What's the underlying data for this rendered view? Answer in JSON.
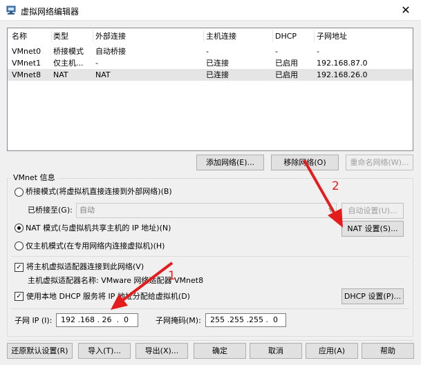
{
  "window": {
    "title": "虚拟网络编辑器",
    "close_glyph": "✕"
  },
  "network_table": {
    "columns": [
      "名称",
      "类型",
      "外部连接",
      "主机连接",
      "DHCP",
      "子网地址"
    ],
    "rows": [
      [
        "VMnet0",
        "桥接模式",
        "自动桥接",
        "-",
        "-",
        "-"
      ],
      [
        "VMnet1",
        "仅主机...",
        "-",
        "已连接",
        "已启用",
        "192.168.87.0"
      ],
      [
        "VMnet8",
        "NAT",
        "NAT",
        "已连接",
        "已启用",
        "192.168.26.0"
      ]
    ],
    "selected_row": 2
  },
  "table_buttons": {
    "add_network": "添加网络(E)...",
    "remove_network": "移除网络(O)",
    "rename_network": "重命名网络(W)..."
  },
  "vmnet_info": {
    "title": "VMnet 信息",
    "bridge_mode_label": "桥接模式(将虚拟机直接连接到外部网络)(B)",
    "bridged_to_label": "已桥接至(G):",
    "bridged_to_value": "自动",
    "auto_settings_button": "自动设置(U)...",
    "nat_mode_label": "NAT 模式(与虚拟机共享主机的 IP 地址)(N)",
    "nat_settings_button": "NAT 设置(S)...",
    "host_only_label": "仅主机模式(在专用网络内连接虚拟机)(H)",
    "selected_mode": "nat",
    "connect_adapter_label": "将主机虚拟适配器连接到此网络(V)",
    "connect_adapter_checked": true,
    "adapter_name_label": "主机虚拟适配器名称: VMware 网络适配器 VMnet8",
    "use_dhcp_label": "使用本地 DHCP 服务将 IP 地址分配给虚拟机(D)",
    "use_dhcp_checked": true,
    "dhcp_settings_button": "DHCP 设置(P)...",
    "subnet_ip_label": "子网 IP (I):",
    "subnet_ip_value": "192 .168 . 26  .  0",
    "subnet_mask_label": "子网掩码(M):",
    "subnet_mask_value": "255 .255 .255 .  0"
  },
  "footer_buttons": {
    "restore_defaults": "还原默认设置(R)",
    "import": "导入(T)...",
    "export": "导出(X)...",
    "ok": "确定",
    "cancel": "取消",
    "apply": "应用(A)",
    "help": "帮助"
  },
  "annotations": {
    "marker_1": "1",
    "marker_2": "2",
    "arrow_color": "#e51c1c"
  }
}
